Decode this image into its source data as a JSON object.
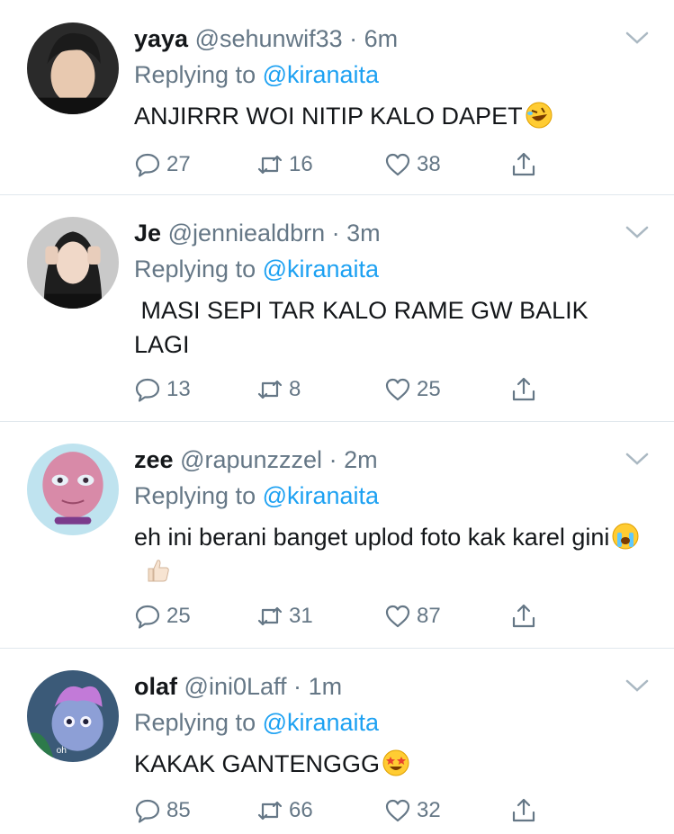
{
  "tweets": [
    {
      "name": "yaya",
      "handle": "@sehunwif33",
      "time": "6m",
      "replying_prefix": "Replying to",
      "replying_to": "@kiranaita",
      "text": "ANJIRRR WOI NITIP KALO DAPET",
      "emojis": [
        "rolling-on-floor-laughing"
      ],
      "replies": "27",
      "retweets": "16",
      "likes": "38"
    },
    {
      "name": "Je",
      "handle": "@jenniealdbrn",
      "time": "3m",
      "replying_prefix": "Replying to",
      "replying_to": "@kiranaita",
      "text": " MASI SEPI TAR KALO RAME GW BALIK LAGI",
      "emojis": [],
      "replies": "13",
      "retweets": "8",
      "likes": "25"
    },
    {
      "name": "zee",
      "handle": "@rapunzzzel",
      "time": "2m",
      "replying_prefix": "Replying to",
      "replying_to": "@kiranaita",
      "text": "eh ini berani banget uplod foto kak karel gini",
      "emojis": [
        "loudly-crying",
        "thumbs-up"
      ],
      "replies": "25",
      "retweets": "31",
      "likes": "87"
    },
    {
      "name": "olaf",
      "handle": "@ini0Laff",
      "time": "1m",
      "replying_prefix": "Replying to",
      "replying_to": "@kiranaita",
      "text": "KAKAK GANTENGGG",
      "emojis": [
        "star-struck"
      ],
      "replies": "85",
      "retweets": "66",
      "likes": "32",
      "avatar_caption": "oh"
    }
  ],
  "separator": "·",
  "icons": {
    "reply": "reply-icon",
    "retweet": "retweet-icon",
    "like": "heart-icon",
    "share": "share-icon",
    "menu": "chevron-down-icon"
  },
  "colors": {
    "text": "#14171a",
    "muted": "#657786",
    "link": "#1da1f2",
    "divider": "#e1e8ed"
  }
}
